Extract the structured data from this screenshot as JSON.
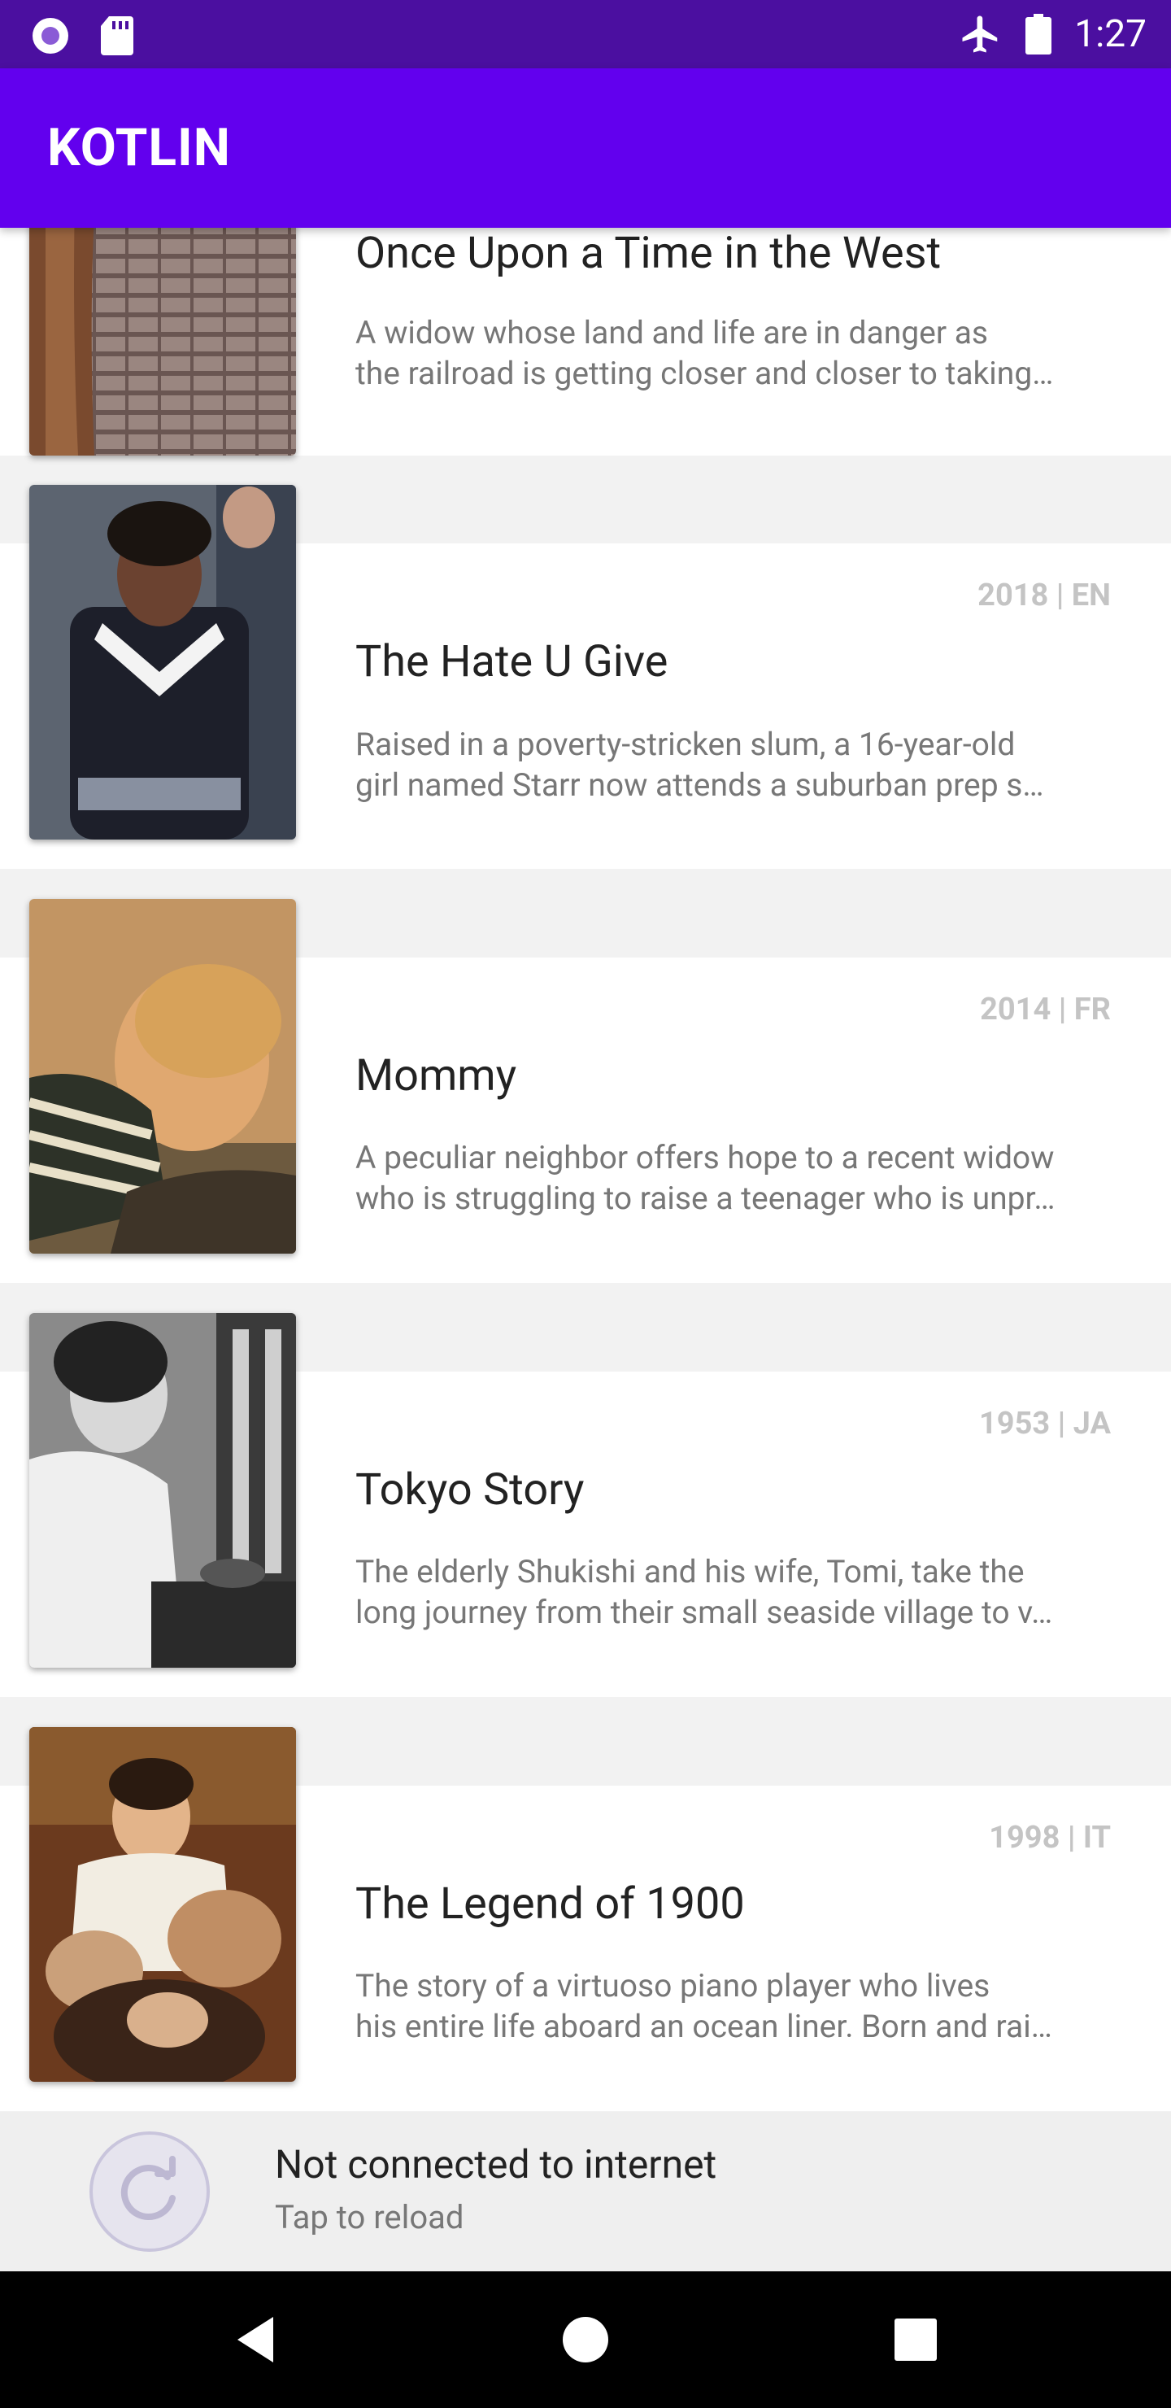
{
  "status_bar": {
    "time": "1:27",
    "icons": [
      "notification-dot-icon",
      "sd-card-icon",
      "airplane-icon",
      "battery-icon"
    ]
  },
  "app_bar": {
    "title": "KOTLIN"
  },
  "movies": [
    {
      "title": "Once Upon a Time in the West",
      "meta": "",
      "description_lines": [
        "A widow whose land and life are in danger as",
        "the railroad is getting closer and closer to taking…"
      ]
    },
    {
      "title": "The Hate U Give",
      "meta": "2018 | EN",
      "description_lines": [
        "Raised in a poverty-stricken slum, a 16-year-old",
        "girl named Starr now attends a suburban prep s…"
      ]
    },
    {
      "title": "Mommy",
      "meta": "2014 | FR",
      "description_lines": [
        "A peculiar neighbor offers hope to a recent widow",
        "who is struggling to raise a teenager who is unpr…"
      ]
    },
    {
      "title": "Tokyo Story",
      "meta": "1953 | JA",
      "description_lines": [
        "The elderly Shukishi and his wife, Tomi, take the",
        "long journey from their small seaside village to v…"
      ]
    },
    {
      "title": "The Legend of 1900",
      "meta": "1998 | IT",
      "description_lines": [
        "The story of a virtuoso piano player who lives",
        "his entire life aboard an ocean liner. Born and rai…"
      ]
    }
  ],
  "snackbar": {
    "title": "Not connected to internet",
    "subtitle": "Tap to reload"
  },
  "colors": {
    "status_bar": "#4b0fa0",
    "app_bar": "#6200ee",
    "list_background": "#f2f2f2",
    "meta_text": "#c4c4c4"
  }
}
